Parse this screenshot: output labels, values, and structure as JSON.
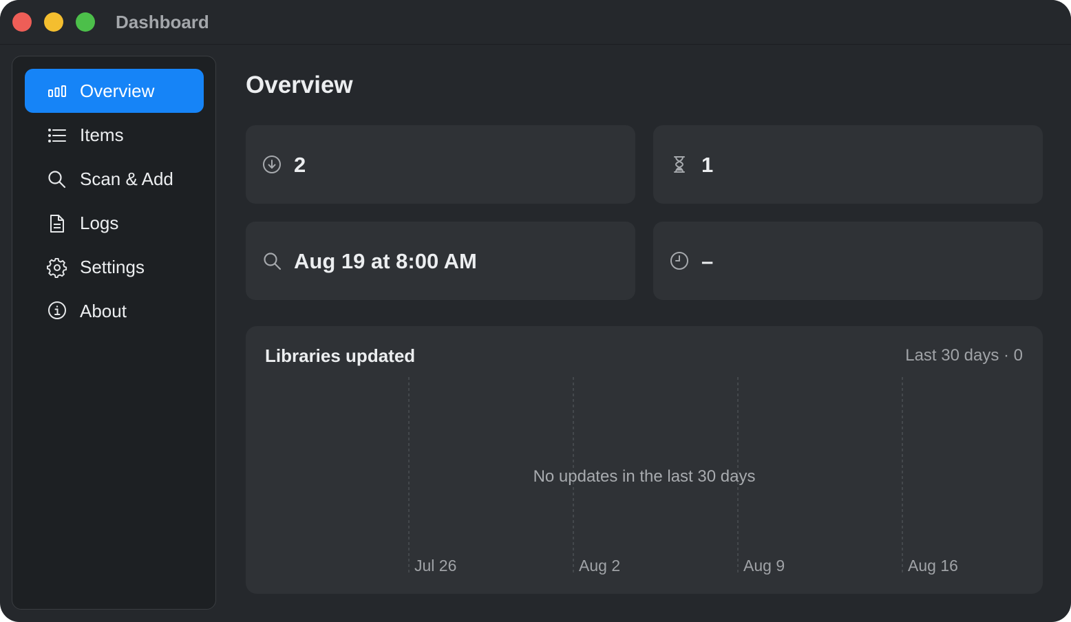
{
  "window": {
    "title": "Dashboard"
  },
  "sidebar": {
    "items": [
      {
        "label": "Overview",
        "icon": "chart-bar-icon",
        "active": true
      },
      {
        "label": "Items",
        "icon": "list-icon",
        "active": false
      },
      {
        "label": "Scan & Add",
        "icon": "magnifier-icon",
        "active": false
      },
      {
        "label": "Logs",
        "icon": "document-icon",
        "active": false
      },
      {
        "label": "Settings",
        "icon": "gear-icon",
        "active": false
      },
      {
        "label": "About",
        "icon": "info-icon",
        "active": false
      }
    ]
  },
  "main": {
    "title": "Overview",
    "cards": [
      {
        "icon": "download-circle-icon",
        "value": "2"
      },
      {
        "icon": "hourglass-icon",
        "value": "1"
      },
      {
        "icon": "magnifier-icon",
        "value": "Aug 19 at 8:00 AM"
      },
      {
        "icon": "clock-icon",
        "value": "–"
      }
    ]
  },
  "chart": {
    "title": "Libraries updated",
    "range_label": "Last 30 days · 0",
    "empty_message": "No updates in the last 30 days"
  },
  "chart_data": {
    "type": "bar",
    "title": "Libraries updated",
    "x_ticks": [
      "Jul 26",
      "Aug 2",
      "Aug 9",
      "Aug 16"
    ],
    "series": [],
    "grid": "vertical dashed"
  },
  "colors": {
    "accent": "#1684f7",
    "window_bg": "#25282c",
    "card_bg": "#2f3236",
    "sidebar_bg": "#1d2023"
  }
}
